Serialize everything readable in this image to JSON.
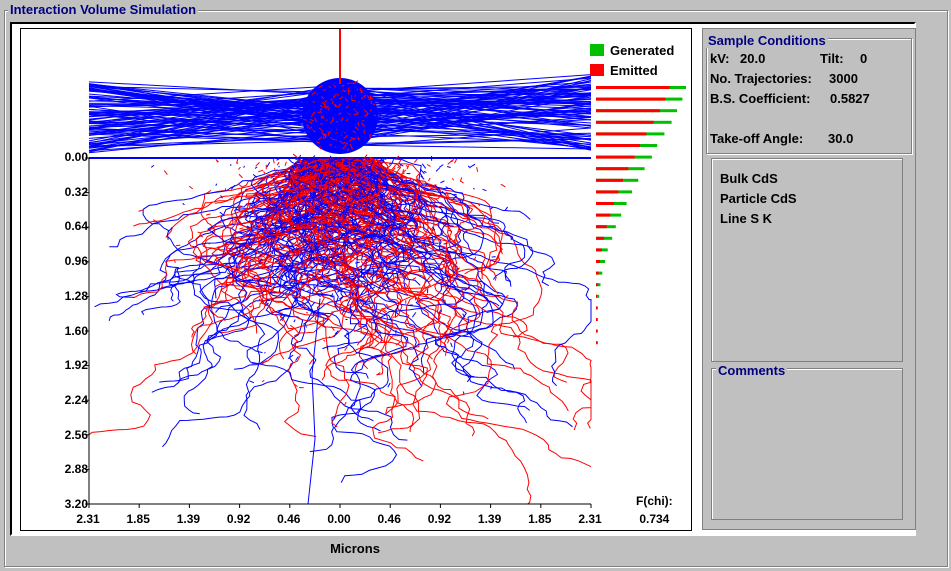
{
  "window": {
    "title": "Interaction Volume Simulation"
  },
  "legend": {
    "generated": "Generated",
    "emitted": "Emitted",
    "generated_color": "#00c000",
    "emitted_color": "#ff0000"
  },
  "fchi": {
    "label": "F(chi):",
    "value": "0.734"
  },
  "x_axis": {
    "title": "Microns",
    "ticks": [
      "2.31",
      "1.85",
      "1.39",
      "0.92",
      "0.46",
      "0.00",
      "0.46",
      "0.92",
      "1.39",
      "1.85",
      "2.31"
    ]
  },
  "y_axis": {
    "ticks": [
      "0.00",
      "0.32",
      "0.64",
      "0.96",
      "1.28",
      "1.60",
      "1.92",
      "2.24",
      "2.56",
      "2.88",
      "3.20"
    ]
  },
  "sample_conditions": {
    "title": "Sample Conditions",
    "kv_label": "kV:",
    "kv_value": "20.0",
    "tilt_label": "Tilt:",
    "tilt_value": "0",
    "traj_label": "No. Trajectories:",
    "traj_value": "3000",
    "bs_label": "B.S. Coefficient:",
    "bs_value": "0.5827",
    "takeoff_label": "Take-off Angle:",
    "takeoff_value": "30.0"
  },
  "sample": {
    "bulk": "Bulk CdS",
    "particle": "Particle CdS",
    "line": "Line S K"
  },
  "comments": {
    "title": "Comments",
    "text": ""
  },
  "colors": {
    "trajectory_above": "#0000ff",
    "trajectory_blue": "#0000ff",
    "trajectory_red": "#ff0000",
    "beam": "#ff0000"
  },
  "chart_data": {
    "type": "scatter",
    "xlabel": "Microns",
    "xlim": [
      -2.31,
      2.31
    ],
    "ylim": [
      0.0,
      3.2
    ],
    "depth_profile": {
      "depths": [
        0.0,
        0.08,
        0.16,
        0.24,
        0.32,
        0.4,
        0.48,
        0.56,
        0.64,
        0.72,
        0.8,
        0.88,
        0.96,
        1.04,
        1.12,
        1.2,
        1.28,
        1.36,
        1.44,
        1.52,
        1.6,
        1.68,
        1.76
      ],
      "generated": [
        1.0,
        0.96,
        0.9,
        0.84,
        0.76,
        0.68,
        0.62,
        0.54,
        0.47,
        0.4,
        0.34,
        0.28,
        0.22,
        0.18,
        0.13,
        0.1,
        0.07,
        0.05,
        0.035,
        0.02,
        0.012,
        0.006,
        0.003
      ],
      "emitted": [
        0.82,
        0.77,
        0.71,
        0.64,
        0.56,
        0.49,
        0.43,
        0.36,
        0.3,
        0.25,
        0.2,
        0.16,
        0.12,
        0.09,
        0.065,
        0.045,
        0.03,
        0.02,
        0.012,
        0.007,
        0.004,
        0.002,
        0.001
      ]
    }
  }
}
